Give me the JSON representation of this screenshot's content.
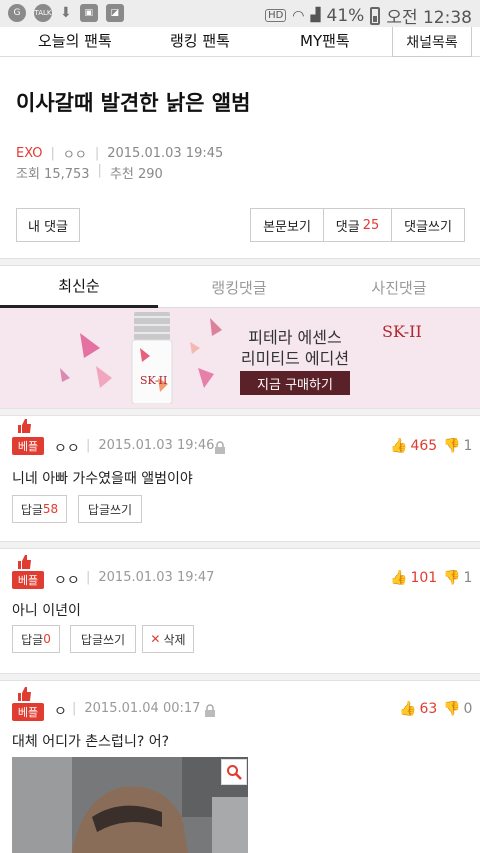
{
  "status_bar": {
    "left_icons": [
      "carrier-icon",
      "talk-icon",
      "download-icon",
      "image-icon",
      "app-icon"
    ],
    "battery": "41%",
    "time": "오전 12:38",
    "hd_label": "HD"
  },
  "nav": {
    "items": [
      "오늘의 팬톡",
      "랭킹 팬톡",
      "MY팬톡"
    ],
    "channel_button": "채널목록"
  },
  "post": {
    "title": "이사갈때 발견한 낡은 앨범",
    "category": "EXO",
    "author": "ㅇㅇ",
    "date": "2015.01.03 19:45",
    "views": "조회 15,753",
    "recommend": "추천 290"
  },
  "actions": {
    "my_comments": "내 댓글",
    "view_body": "본문보기",
    "comments_label": "댓글",
    "comments_count": "25",
    "write_comment": "댓글쓰기"
  },
  "tabs": {
    "latest": "최신순",
    "ranking": "랭킹댓글",
    "photo": "사진댓글"
  },
  "ad": {
    "line1": "피테라 에센스",
    "line2": "리미티드 에디션",
    "cta": "지금 구매하기",
    "brand": "SK-II",
    "bottle_label": "SK-II"
  },
  "comments": [
    {
      "badge": "베플",
      "author": "ㅇㅇ",
      "date": "2015.01.03 19:46",
      "likes": "465",
      "dislikes": "1",
      "text": "니네 아빠 가수였을때 앨범이야",
      "reply_label": "답글",
      "reply_count": "58",
      "write_reply": "답글쓰기"
    },
    {
      "badge": "베플",
      "author": "ㅇㅇ",
      "date": "2015.01.03 19:47",
      "likes": "101",
      "dislikes": "1",
      "text": "아니 이년이",
      "reply_label": "답글",
      "reply_count": "0",
      "write_reply": "답글쓰기",
      "delete": "삭제"
    },
    {
      "badge": "베플",
      "author": "ㅇ",
      "date": "2015.01.04 00:17",
      "likes": "63",
      "dislikes": "0",
      "text": "대체 어디가 촌스럽니? 어?"
    }
  ],
  "colors": {
    "accent": "#e03c31",
    "ad_background": "#f6e6ee",
    "ad_cta": "#5a2228"
  }
}
